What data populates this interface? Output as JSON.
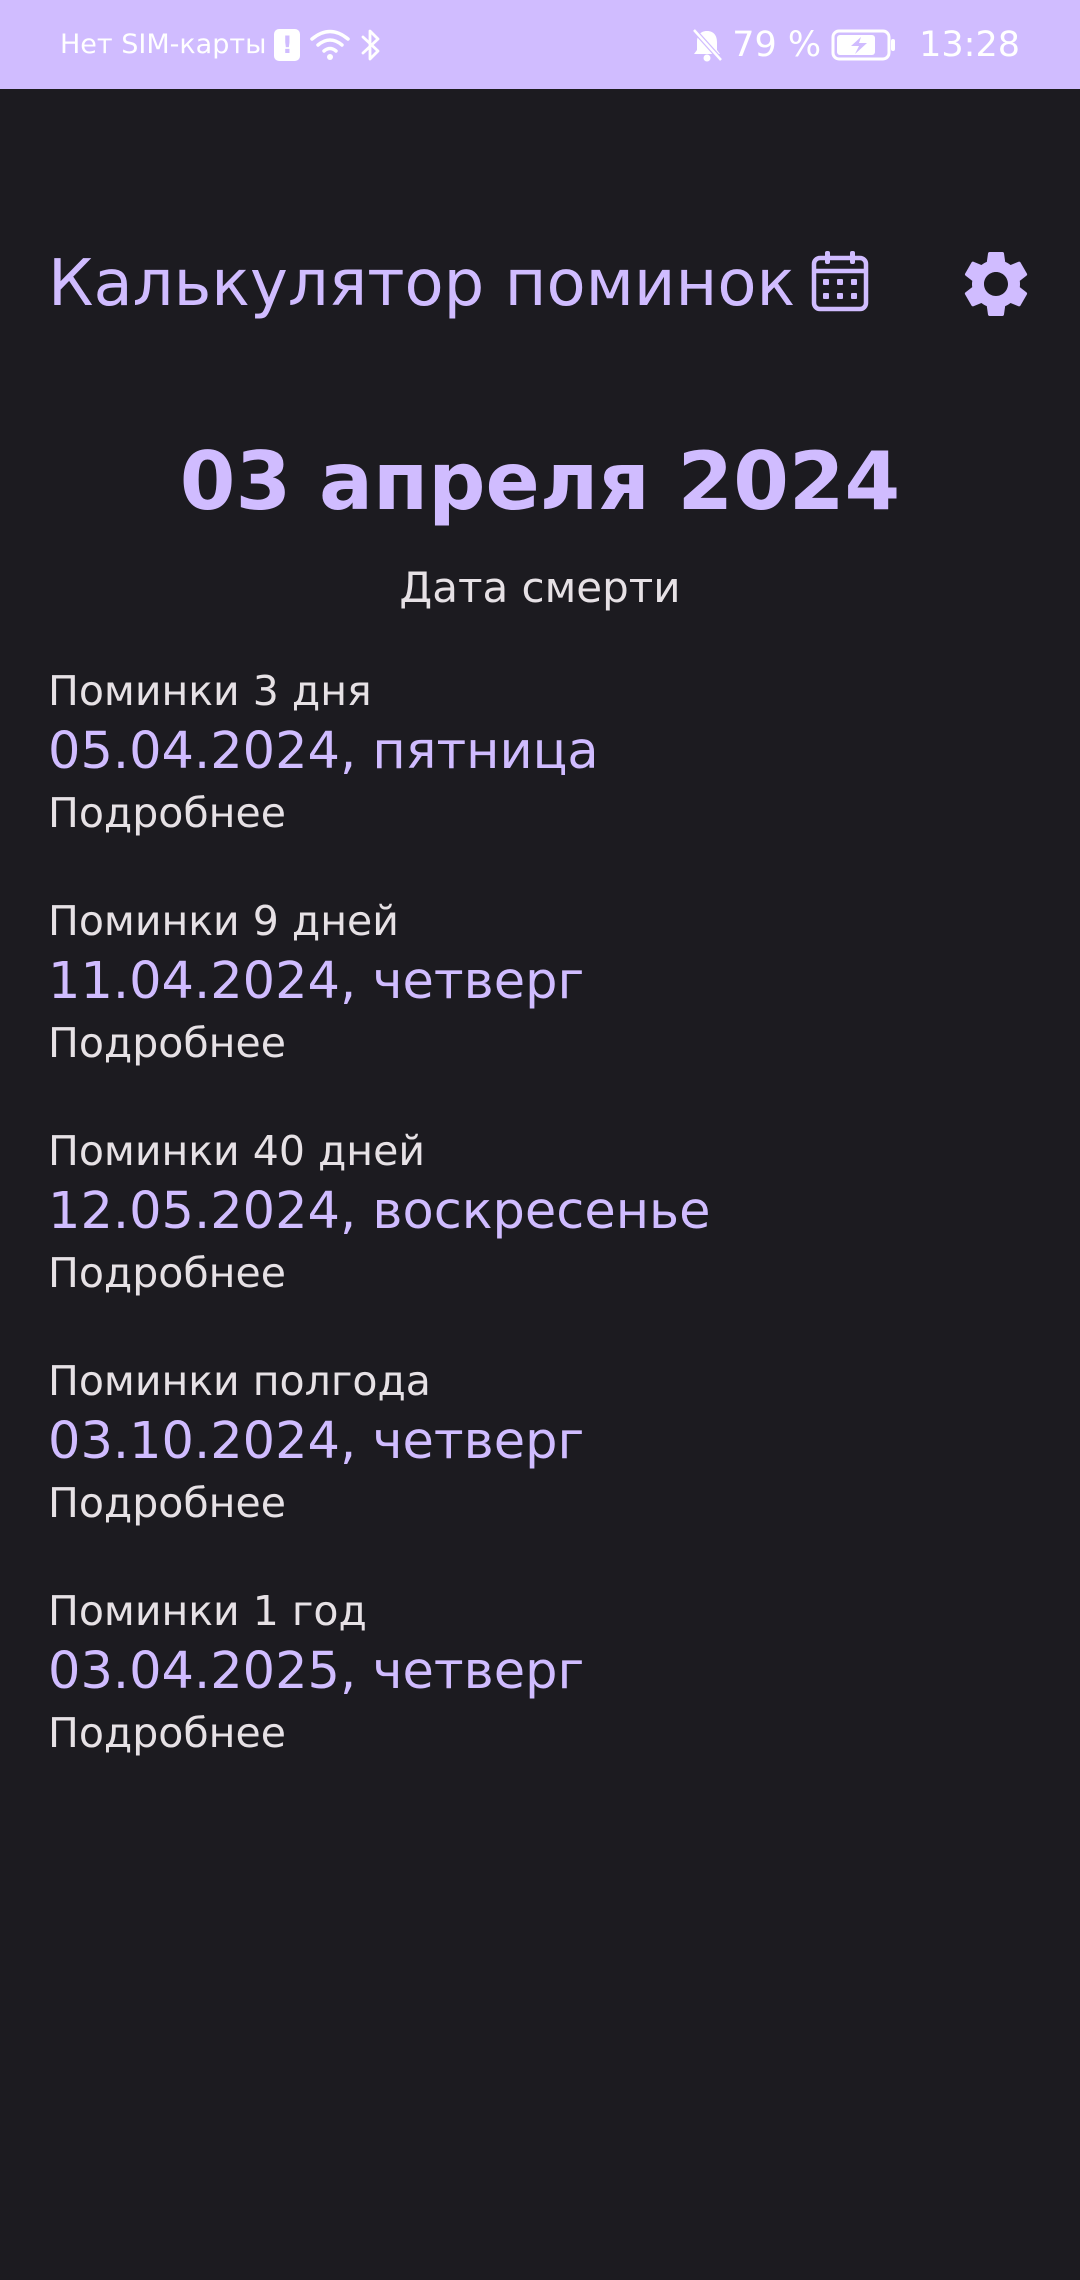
{
  "status_bar": {
    "carrier": "Нет SIM-карты",
    "battery": "79 %",
    "time": "13:28",
    "background": "#d0bcff",
    "icons": [
      "sim-alert-icon",
      "wifi-icon",
      "bluetooth-icon",
      "bell-off-icon",
      "battery-charging-icon"
    ]
  },
  "header": {
    "title": "Калькулятор поминок",
    "calendar_icon": "calendar-icon",
    "settings_icon": "gear-icon"
  },
  "death": {
    "date": "03 апреля 2024",
    "label": "Дата смерти"
  },
  "events": [
    {
      "title": "Поминки 3 дня",
      "date": "05.04.2024, пятница",
      "more": "Подробнее"
    },
    {
      "title": "Поминки 9 дней",
      "date": "11.04.2024, четверг",
      "more": "Подробнее"
    },
    {
      "title": "Поминки 40 дней",
      "date": "12.05.2024, воскресенье",
      "more": "Подробнее"
    },
    {
      "title": "Поминки полгода",
      "date": "03.10.2024, четверг",
      "more": "Подробнее"
    },
    {
      "title": "Поминки 1 год",
      "date": "03.04.2025, четверг",
      "more": "Подробнее"
    }
  ],
  "colors": {
    "accent": "#d0bcff",
    "background": "#1c1b20",
    "text": "#e6e1e5"
  }
}
